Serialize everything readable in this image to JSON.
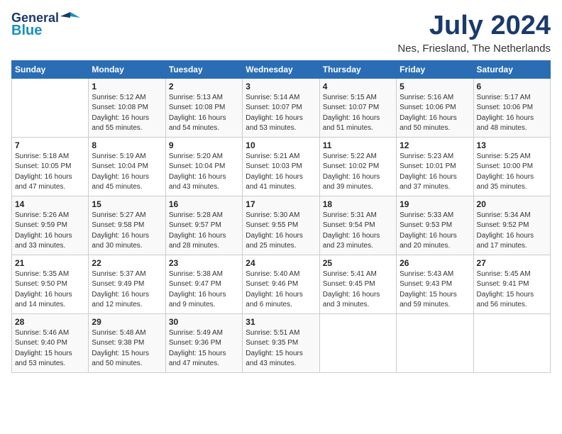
{
  "logo": {
    "line1": "General",
    "line2": "Blue"
  },
  "title": "July 2024",
  "subtitle": "Nes, Friesland, The Netherlands",
  "days_header": [
    "Sunday",
    "Monday",
    "Tuesday",
    "Wednesday",
    "Thursday",
    "Friday",
    "Saturday"
  ],
  "weeks": [
    [
      {
        "num": "",
        "info": ""
      },
      {
        "num": "1",
        "info": "Sunrise: 5:12 AM\nSunset: 10:08 PM\nDaylight: 16 hours\nand 55 minutes."
      },
      {
        "num": "2",
        "info": "Sunrise: 5:13 AM\nSunset: 10:08 PM\nDaylight: 16 hours\nand 54 minutes."
      },
      {
        "num": "3",
        "info": "Sunrise: 5:14 AM\nSunset: 10:07 PM\nDaylight: 16 hours\nand 53 minutes."
      },
      {
        "num": "4",
        "info": "Sunrise: 5:15 AM\nSunset: 10:07 PM\nDaylight: 16 hours\nand 51 minutes."
      },
      {
        "num": "5",
        "info": "Sunrise: 5:16 AM\nSunset: 10:06 PM\nDaylight: 16 hours\nand 50 minutes."
      },
      {
        "num": "6",
        "info": "Sunrise: 5:17 AM\nSunset: 10:06 PM\nDaylight: 16 hours\nand 48 minutes."
      }
    ],
    [
      {
        "num": "7",
        "info": "Sunrise: 5:18 AM\nSunset: 10:05 PM\nDaylight: 16 hours\nand 47 minutes."
      },
      {
        "num": "8",
        "info": "Sunrise: 5:19 AM\nSunset: 10:04 PM\nDaylight: 16 hours\nand 45 minutes."
      },
      {
        "num": "9",
        "info": "Sunrise: 5:20 AM\nSunset: 10:04 PM\nDaylight: 16 hours\nand 43 minutes."
      },
      {
        "num": "10",
        "info": "Sunrise: 5:21 AM\nSunset: 10:03 PM\nDaylight: 16 hours\nand 41 minutes."
      },
      {
        "num": "11",
        "info": "Sunrise: 5:22 AM\nSunset: 10:02 PM\nDaylight: 16 hours\nand 39 minutes."
      },
      {
        "num": "12",
        "info": "Sunrise: 5:23 AM\nSunset: 10:01 PM\nDaylight: 16 hours\nand 37 minutes."
      },
      {
        "num": "13",
        "info": "Sunrise: 5:25 AM\nSunset: 10:00 PM\nDaylight: 16 hours\nand 35 minutes."
      }
    ],
    [
      {
        "num": "14",
        "info": "Sunrise: 5:26 AM\nSunset: 9:59 PM\nDaylight: 16 hours\nand 33 minutes."
      },
      {
        "num": "15",
        "info": "Sunrise: 5:27 AM\nSunset: 9:58 PM\nDaylight: 16 hours\nand 30 minutes."
      },
      {
        "num": "16",
        "info": "Sunrise: 5:28 AM\nSunset: 9:57 PM\nDaylight: 16 hours\nand 28 minutes."
      },
      {
        "num": "17",
        "info": "Sunrise: 5:30 AM\nSunset: 9:55 PM\nDaylight: 16 hours\nand 25 minutes."
      },
      {
        "num": "18",
        "info": "Sunrise: 5:31 AM\nSunset: 9:54 PM\nDaylight: 16 hours\nand 23 minutes."
      },
      {
        "num": "19",
        "info": "Sunrise: 5:33 AM\nSunset: 9:53 PM\nDaylight: 16 hours\nand 20 minutes."
      },
      {
        "num": "20",
        "info": "Sunrise: 5:34 AM\nSunset: 9:52 PM\nDaylight: 16 hours\nand 17 minutes."
      }
    ],
    [
      {
        "num": "21",
        "info": "Sunrise: 5:35 AM\nSunset: 9:50 PM\nDaylight: 16 hours\nand 14 minutes."
      },
      {
        "num": "22",
        "info": "Sunrise: 5:37 AM\nSunset: 9:49 PM\nDaylight: 16 hours\nand 12 minutes."
      },
      {
        "num": "23",
        "info": "Sunrise: 5:38 AM\nSunset: 9:47 PM\nDaylight: 16 hours\nand 9 minutes."
      },
      {
        "num": "24",
        "info": "Sunrise: 5:40 AM\nSunset: 9:46 PM\nDaylight: 16 hours\nand 6 minutes."
      },
      {
        "num": "25",
        "info": "Sunrise: 5:41 AM\nSunset: 9:45 PM\nDaylight: 16 hours\nand 3 minutes."
      },
      {
        "num": "26",
        "info": "Sunrise: 5:43 AM\nSunset: 9:43 PM\nDaylight: 15 hours\nand 59 minutes."
      },
      {
        "num": "27",
        "info": "Sunrise: 5:45 AM\nSunset: 9:41 PM\nDaylight: 15 hours\nand 56 minutes."
      }
    ],
    [
      {
        "num": "28",
        "info": "Sunrise: 5:46 AM\nSunset: 9:40 PM\nDaylight: 15 hours\nand 53 minutes."
      },
      {
        "num": "29",
        "info": "Sunrise: 5:48 AM\nSunset: 9:38 PM\nDaylight: 15 hours\nand 50 minutes."
      },
      {
        "num": "30",
        "info": "Sunrise: 5:49 AM\nSunset: 9:36 PM\nDaylight: 15 hours\nand 47 minutes."
      },
      {
        "num": "31",
        "info": "Sunrise: 5:51 AM\nSunset: 9:35 PM\nDaylight: 15 hours\nand 43 minutes."
      },
      {
        "num": "",
        "info": ""
      },
      {
        "num": "",
        "info": ""
      },
      {
        "num": "",
        "info": ""
      }
    ]
  ]
}
